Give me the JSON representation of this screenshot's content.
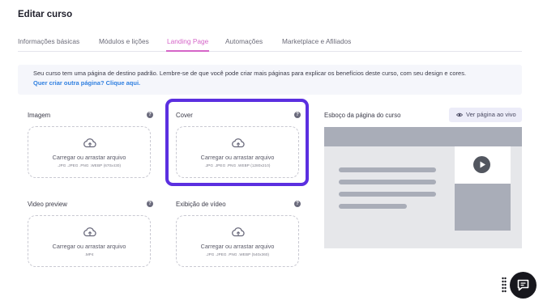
{
  "page": {
    "title": "Editar curso"
  },
  "tabs": [
    {
      "label": "Informações básicas",
      "active": false
    },
    {
      "label": "Módulos e lições",
      "active": false
    },
    {
      "label": "Landing Page",
      "active": true
    },
    {
      "label": "Automações",
      "active": false
    },
    {
      "label": "Marketplace e Afiliados",
      "active": false
    }
  ],
  "info": {
    "text": "Seu curso tem uma página de destino padrão. Lembre-se de que você pode criar mais páginas para explicar os benefícios deste curso, com seu design e cores.",
    "link": "Quer criar outra página? Clique aqui."
  },
  "fields": {
    "imagem": {
      "label": "Imagem",
      "cta": "Carregar ou arrastar arquivo",
      "formats": ".JPG .JPEG .PNG .WEBP (670x430)"
    },
    "cover": {
      "label": "Cover",
      "cta": "Carregar ou arrastar arquivo",
      "formats": ".JPG .JPEG .PNG .WEBP (1280x210)"
    },
    "video_preview": {
      "label": "Video preview",
      "cta": "Carregar ou arrastar arquivo",
      "formats": ".MP4"
    },
    "exibicao_video": {
      "label": "Exibição de vídeo",
      "cta": "Carregar ou arrastar arquivo",
      "formats": ".JPG .JPEG .PNG .WEBP (540x360)"
    }
  },
  "preview": {
    "title": "Esboço da página do curso",
    "button_label": "Ver página ao vivo"
  },
  "colors": {
    "accent": "#d565c8",
    "highlight": "#5b2fe0",
    "link": "#2f7fe0",
    "chat": "#17171d"
  },
  "icons": [
    "help-icon",
    "cloud-upload-icon",
    "eye-icon",
    "play-icon",
    "chat-icon",
    "drag-grip-icon"
  ]
}
